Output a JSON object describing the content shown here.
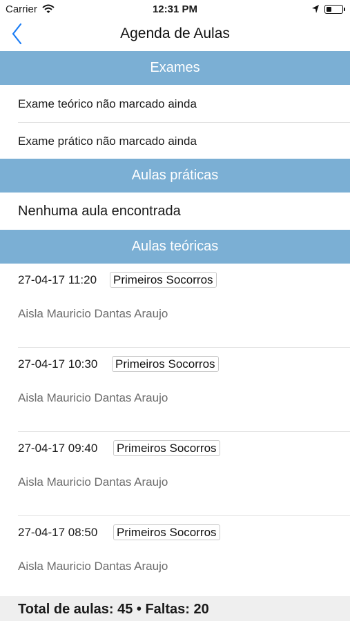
{
  "status_bar": {
    "carrier": "Carrier",
    "time": "12:31 PM",
    "icons": [
      "wifi-icon",
      "location-arrow-icon",
      "battery-icon"
    ]
  },
  "nav": {
    "back_icon": "chevron-left-icon",
    "title": "Agenda de Aulas",
    "accent_color": "#1a7cf5"
  },
  "sections": {
    "exams": {
      "title": "Exames",
      "items": [
        "Exame teórico não marcado ainda",
        "Exame prático não marcado ainda"
      ]
    },
    "practical": {
      "title": "Aulas práticas",
      "empty_text": "Nenhuma aula encontrada"
    },
    "theory": {
      "title": "Aulas teóricas",
      "classes": [
        {
          "datetime": "27-04-17 11:20",
          "subject": "Primeiros Socorros",
          "instructor": "Aisla Mauricio Dantas Araujo"
        },
        {
          "datetime": "27-04-17 10:30",
          "subject": "Primeiros Socorros",
          "instructor": "Aisla Mauricio Dantas Araujo"
        },
        {
          "datetime": "27-04-17 09:40",
          "subject": "Primeiros Socorros",
          "instructor": "Aisla Mauricio Dantas Araujo"
        },
        {
          "datetime": "27-04-17 08:50",
          "subject": "Primeiros Socorros",
          "instructor": "Aisla Mauricio Dantas Araujo"
        }
      ]
    }
  },
  "footer": {
    "summary": "Total de aulas: 45 • Faltas: 20"
  },
  "colors": {
    "section_header": "#7bafd4",
    "footer_background": "#efefef"
  }
}
